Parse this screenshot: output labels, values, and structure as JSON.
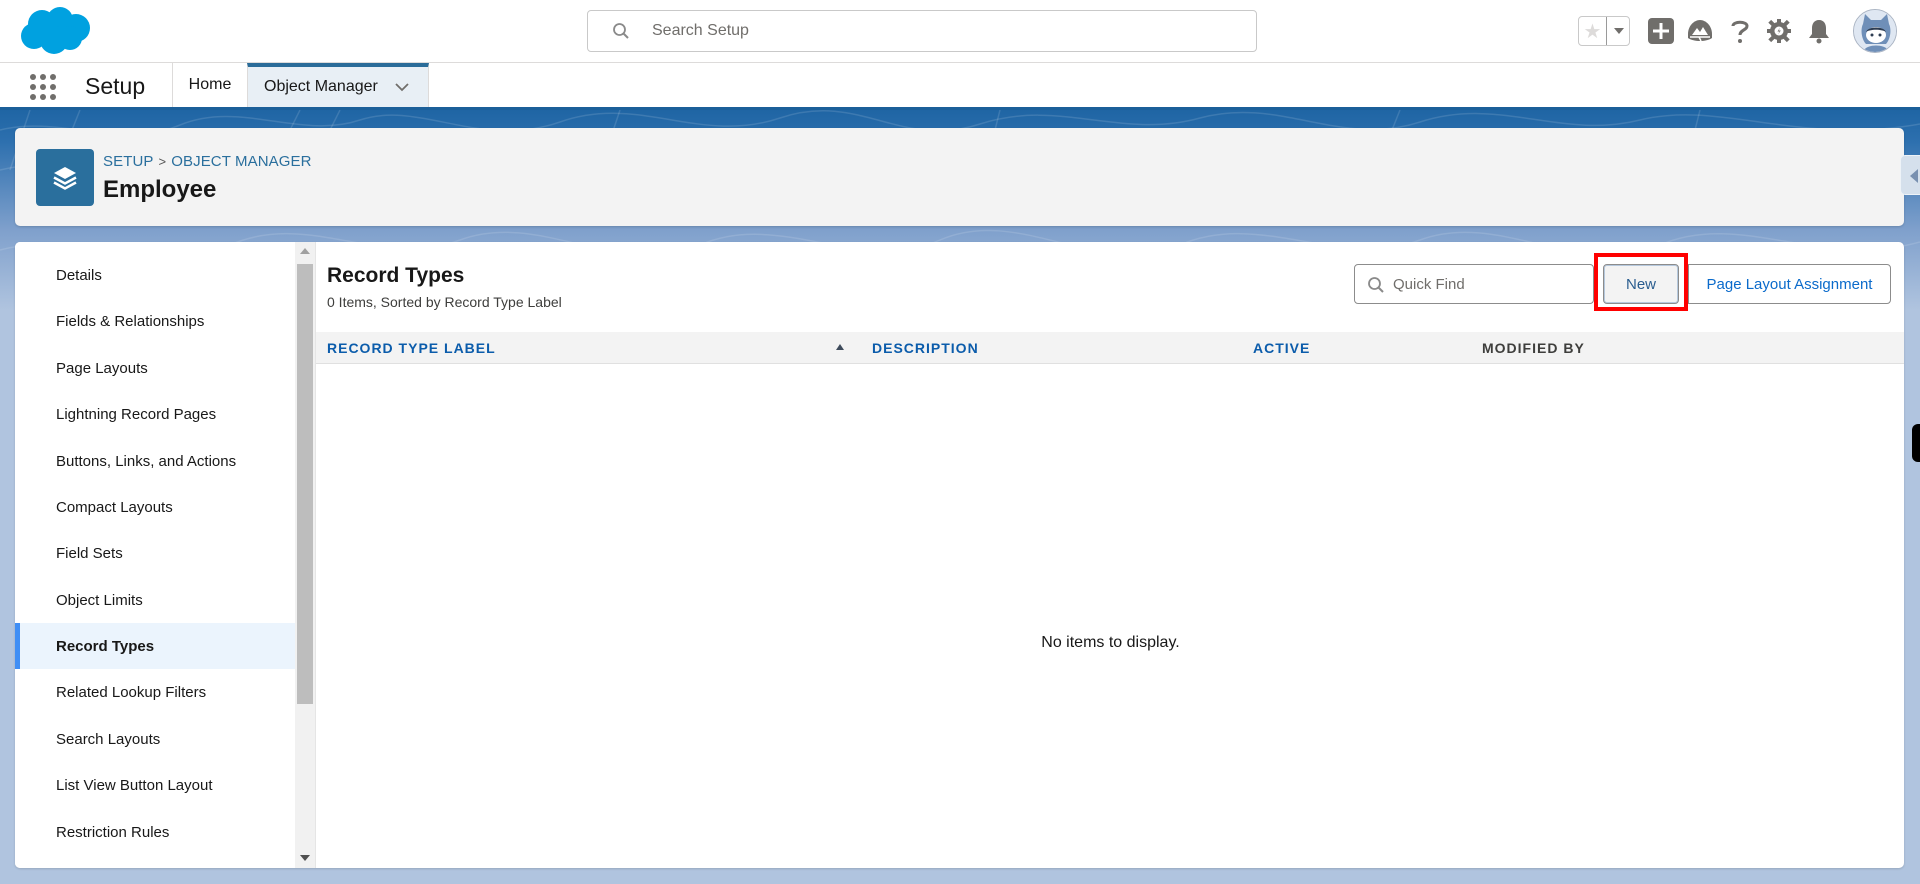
{
  "header": {
    "logo": "salesforce-cloud-logo",
    "search_placeholder": "Search Setup",
    "icons": [
      "favorites-star-icon",
      "favorites-dropdown-icon",
      "global-actions-plus-icon",
      "trailhead-icon",
      "help-icon",
      "setup-gear-icon",
      "notifications-bell-icon",
      "user-avatar"
    ]
  },
  "nav": {
    "app_name": "Setup",
    "tabs": [
      {
        "label": "Home",
        "active": false
      },
      {
        "label": "Object Manager",
        "active": true
      }
    ]
  },
  "page_header": {
    "breadcrumb": [
      "SETUP",
      "OBJECT MANAGER"
    ],
    "breadcrumb_sep": ">",
    "title": "Employee",
    "icon": "layers-icon"
  },
  "sidebar": {
    "items": [
      {
        "label": "Details",
        "active": false
      },
      {
        "label": "Fields & Relationships",
        "active": false
      },
      {
        "label": "Page Layouts",
        "active": false
      },
      {
        "label": "Lightning Record Pages",
        "active": false
      },
      {
        "label": "Buttons, Links, and Actions",
        "active": false
      },
      {
        "label": "Compact Layouts",
        "active": false
      },
      {
        "label": "Field Sets",
        "active": false
      },
      {
        "label": "Object Limits",
        "active": false
      },
      {
        "label": "Record Types",
        "active": true
      },
      {
        "label": "Related Lookup Filters",
        "active": false
      },
      {
        "label": "Search Layouts",
        "active": false
      },
      {
        "label": "List View Button Layout",
        "active": false
      },
      {
        "label": "Restriction Rules",
        "active": false
      }
    ]
  },
  "content": {
    "title": "Record Types",
    "subtitle": "0 Items, Sorted by Record Type Label",
    "quick_find_placeholder": "Quick Find",
    "new_button": "New",
    "page_layout_button": "Page Layout Assignment",
    "columns": [
      {
        "label": "RECORD TYPE LABEL",
        "sortable": true,
        "sorted": "asc"
      },
      {
        "label": "DESCRIPTION",
        "sortable": true
      },
      {
        "label": "ACTIVE",
        "sortable": true
      },
      {
        "label": "MODIFIED BY",
        "sortable": false
      }
    ],
    "rows": [],
    "empty_message": "No items to display."
  },
  "colors": {
    "brand_blue": "#00a1e0",
    "link_blue": "#0b5cab",
    "object_icon": "#2a6f9d",
    "active_item_bg": "#ebf4fd",
    "active_item_bar": "#3f8ef5",
    "highlight_red": "#ff0000"
  }
}
